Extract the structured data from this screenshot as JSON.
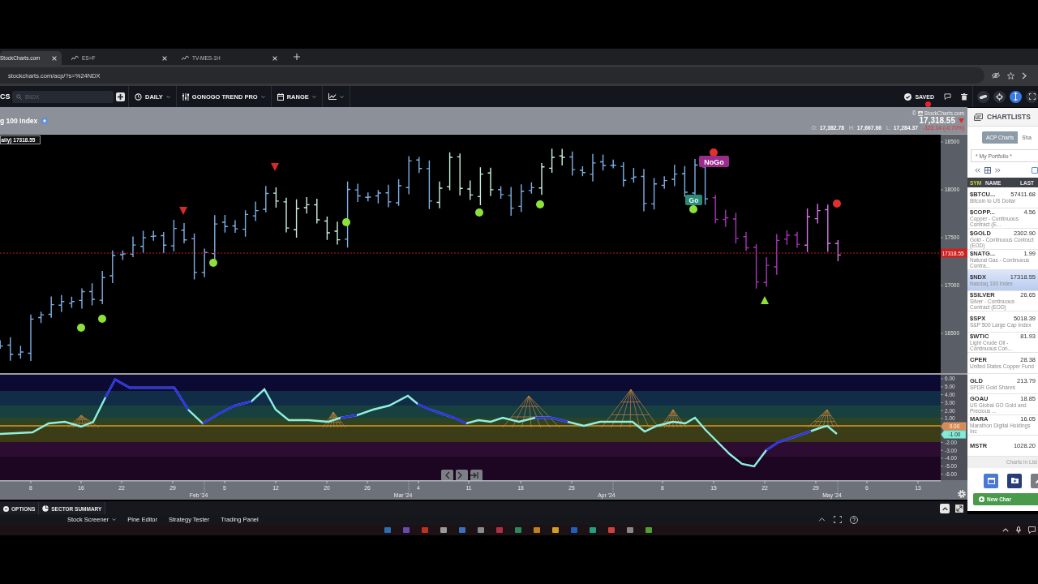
{
  "browser": {
    "tabs": [
      {
        "title": "StockCharts.com",
        "selected": true
      },
      {
        "title": "ES=F",
        "selected": false
      },
      {
        "title": "TV-MES-1H",
        "selected": false
      }
    ],
    "url": "stockcharts.com/acp/?s=%24NDX"
  },
  "toolbar": {
    "brand": "CS",
    "search": {
      "placeholder": "$NDX"
    },
    "menus": [
      {
        "kind": "period",
        "label": "DAILY"
      },
      {
        "kind": "style",
        "label": "GONOGO TREND PRO"
      },
      {
        "kind": "range",
        "label": "RANGE"
      },
      {
        "kind": "chart-type"
      }
    ],
    "status": "SAVED"
  },
  "chart_header": {
    "title": "g 100 Index",
    "copyright": "©",
    "source": "StockCharts.com",
    "last": "17,318.55",
    "price_down": true,
    "ohlc": [
      {
        "label": "O:",
        "value": "17,382.78"
      },
      {
        "label": "H:",
        "value": "17,667.86"
      },
      {
        "label": "L:",
        "value": "17,284.37"
      }
    ],
    "change": "-122.14 (-0.70%)"
  },
  "price_chart": {
    "legend": "aily) 17318.55",
    "y_axis_labels": [
      "18500",
      "18000",
      "17500",
      "17000",
      "16500"
    ],
    "last_price_label": "17318.55",
    "signal_labels": [
      {
        "kind": "nogo",
        "text": "NoGo"
      },
      {
        "kind": "go",
        "text": "Go"
      }
    ]
  },
  "oscillator": {
    "y_axis_labels": [
      {
        "text": "6.00",
        "kind": "plain"
      },
      {
        "text": "5.00",
        "kind": "plain"
      },
      {
        "text": "4.00",
        "kind": "plain"
      },
      {
        "text": "3.00",
        "kind": "plain"
      },
      {
        "text": "2.00",
        "kind": "plain"
      },
      {
        "text": "1.00",
        "kind": "plain"
      },
      {
        "text": "0.00",
        "kind": "zero"
      },
      {
        "text": "-1.00",
        "kind": "current"
      },
      {
        "text": "-2.00",
        "kind": "plain"
      },
      {
        "text": "-3.00",
        "kind": "plain"
      },
      {
        "text": "-4.00",
        "kind": "plain"
      },
      {
        "text": "-5.00",
        "kind": "plain"
      },
      {
        "text": "-6.00",
        "kind": "plain"
      }
    ]
  },
  "time_axis": {
    "days": [
      "8",
      "16",
      "22",
      "29",
      "5",
      "12",
      "20",
      "26",
      "4",
      "11",
      "18",
      "25",
      "8",
      "15",
      "22",
      "29",
      "6",
      "13"
    ],
    "months": [
      "Feb '24",
      "Mar '24",
      "Apr '24",
      "May '24"
    ]
  },
  "options_bar": {
    "buttons": [
      {
        "kind": "options",
        "label": "OPTIONS"
      },
      {
        "kind": "sector",
        "label": "SECTOR SUMMARY"
      }
    ]
  },
  "bottom_panel": {
    "tabs": [
      {
        "kind": "dropdown",
        "label": "Stock Screener"
      },
      {
        "kind": "plain",
        "label": "Pine Editor"
      },
      {
        "kind": "plain",
        "label": "Strategy Tester"
      },
      {
        "kind": "plain",
        "label": "Trading Panel"
      }
    ]
  },
  "chartlists": {
    "title": "CHARTLISTS",
    "tabs": [
      {
        "label": "ACP Charts",
        "selected": true
      },
      {
        "label": "Sha",
        "selected": false
      }
    ],
    "list": "* My Portfolio *",
    "select_all": {
      "checked": false
    },
    "columns": [
      "SYM",
      "NAME",
      "LAST"
    ],
    "rows": [
      {
        "symbol": "$BTCU...",
        "last": "57411.68",
        "name": "Bitcoin to US Dollar",
        "selected": false
      },
      {
        "symbol": "$COPP...",
        "last": "4.56",
        "name": "Copper - Continuous Contract (E...",
        "selected": false
      },
      {
        "symbol": "$GOLD",
        "last": "2302.90",
        "name": "Gold - Continuous Contract (EOD)",
        "selected": false
      },
      {
        "symbol": "$NATG...",
        "last": "1.99",
        "name": "Natural Gas - Continuous Contra...",
        "selected": false
      },
      {
        "symbol": "$NDX",
        "last": "17318.55",
        "name": "Nasdaq 100 Index",
        "selected": true
      },
      {
        "symbol": "$SILVER",
        "last": "26.65",
        "name": "Silver - Continuous Contract (EOD)",
        "selected": false
      },
      {
        "symbol": "$SPX",
        "last": "5018.39",
        "name": "S&P 500 Large Cap Index",
        "selected": false
      },
      {
        "symbol": "$WTIC",
        "last": "81.93",
        "name": "Light Crude Oil - Continuous Con...",
        "selected": false
      },
      {
        "symbol": "CPER",
        "last": "28.38",
        "name": "United States Copper Fund",
        "selected": false
      },
      {
        "symbol": "GLD",
        "last": "213.79",
        "name": "SPDR Gold Shares",
        "selected": false
      },
      {
        "symbol": "GOAU",
        "last": "18.85",
        "name": "US Global GO Gold and Precious ...",
        "selected": false
      },
      {
        "symbol": "MARA",
        "last": "16.05",
        "name": "Marathon Digital Holdings Inc",
        "selected": false
      },
      {
        "symbol": "MSTR",
        "last": "1028.20",
        "selected": false
      }
    ],
    "footer": "Charts in List",
    "new_button": "New Char"
  }
}
